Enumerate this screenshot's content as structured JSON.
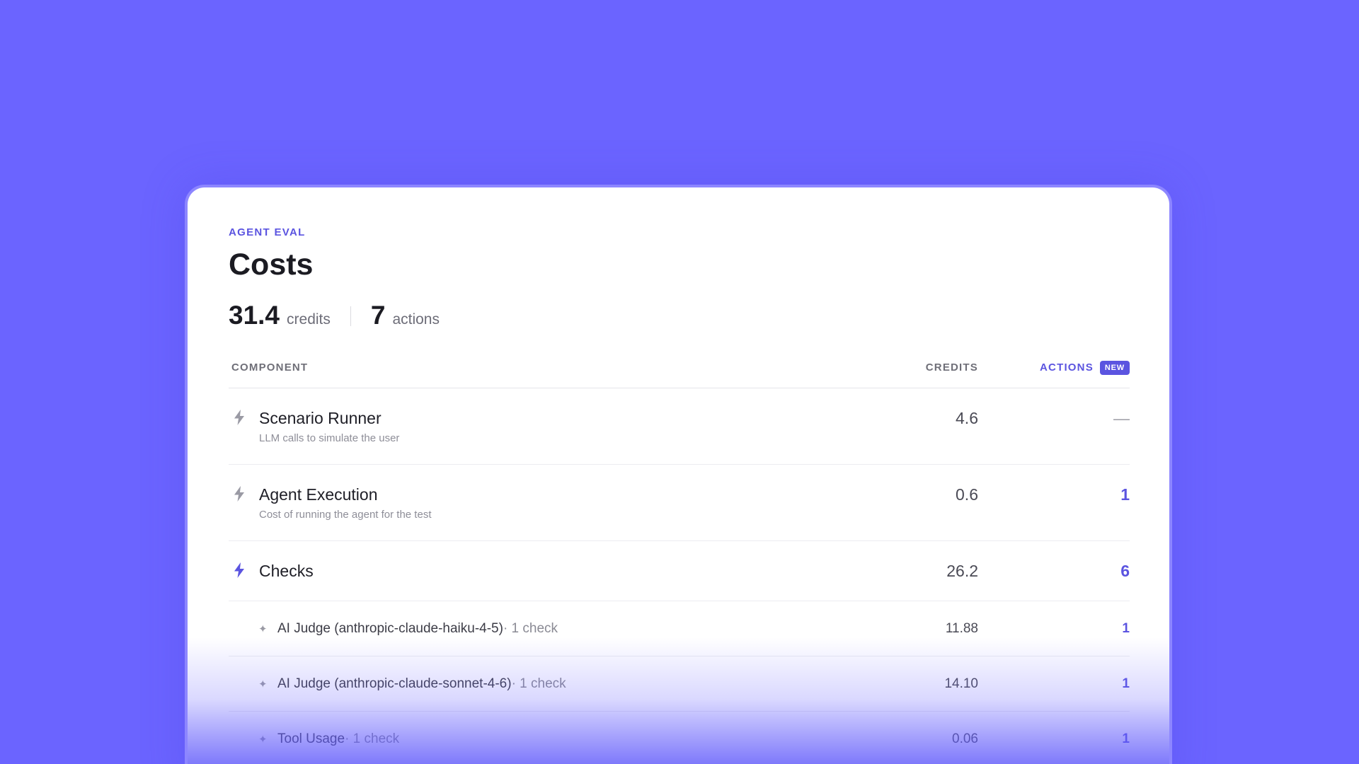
{
  "header": {
    "eyebrow": "AGENT EVAL",
    "title": "Costs"
  },
  "stats": {
    "credits_value": "31.4",
    "credits_label": "credits",
    "actions_value": "7",
    "actions_label": "actions"
  },
  "table": {
    "columns": {
      "component": "COMPONENT",
      "credits": "CREDITS",
      "actions": "ACTIONS",
      "actions_badge": "NEW"
    },
    "rows": [
      {
        "name": "Scenario Runner",
        "desc": "LLM calls to simulate the user",
        "credits": "4.6",
        "actions": "—",
        "icon": "bolt-icon",
        "icon_color": "#9a9aa4"
      },
      {
        "name": "Agent Execution",
        "desc": "Cost of running the agent for the test",
        "credits": "0.6",
        "actions": "1",
        "icon": "bolt-icon",
        "icon_color": "#9a9aa4"
      },
      {
        "name": "Checks",
        "desc": "",
        "credits": "26.2",
        "actions": "6",
        "icon": "bolt-icon",
        "icon_color": "#5b54e0"
      }
    ],
    "sub_rows": [
      {
        "name": "AI Judge (anthropic-claude-haiku-4-5)",
        "meta": " · 1 check",
        "credits": "11.88",
        "actions": "1",
        "icon": "sparkle-icon"
      },
      {
        "name": "AI Judge (anthropic-claude-sonnet-4-6)",
        "meta": " · 1 check",
        "credits": "14.10",
        "actions": "1",
        "icon": "sparkle-icon"
      },
      {
        "name": "Tool Usage",
        "meta": " · 1 check",
        "credits": "0.06",
        "actions": "1",
        "icon": "sparkle-icon"
      }
    ]
  },
  "colors": {
    "background": "#6b64ff",
    "accent": "#5b54e0",
    "card": "#ffffff"
  }
}
